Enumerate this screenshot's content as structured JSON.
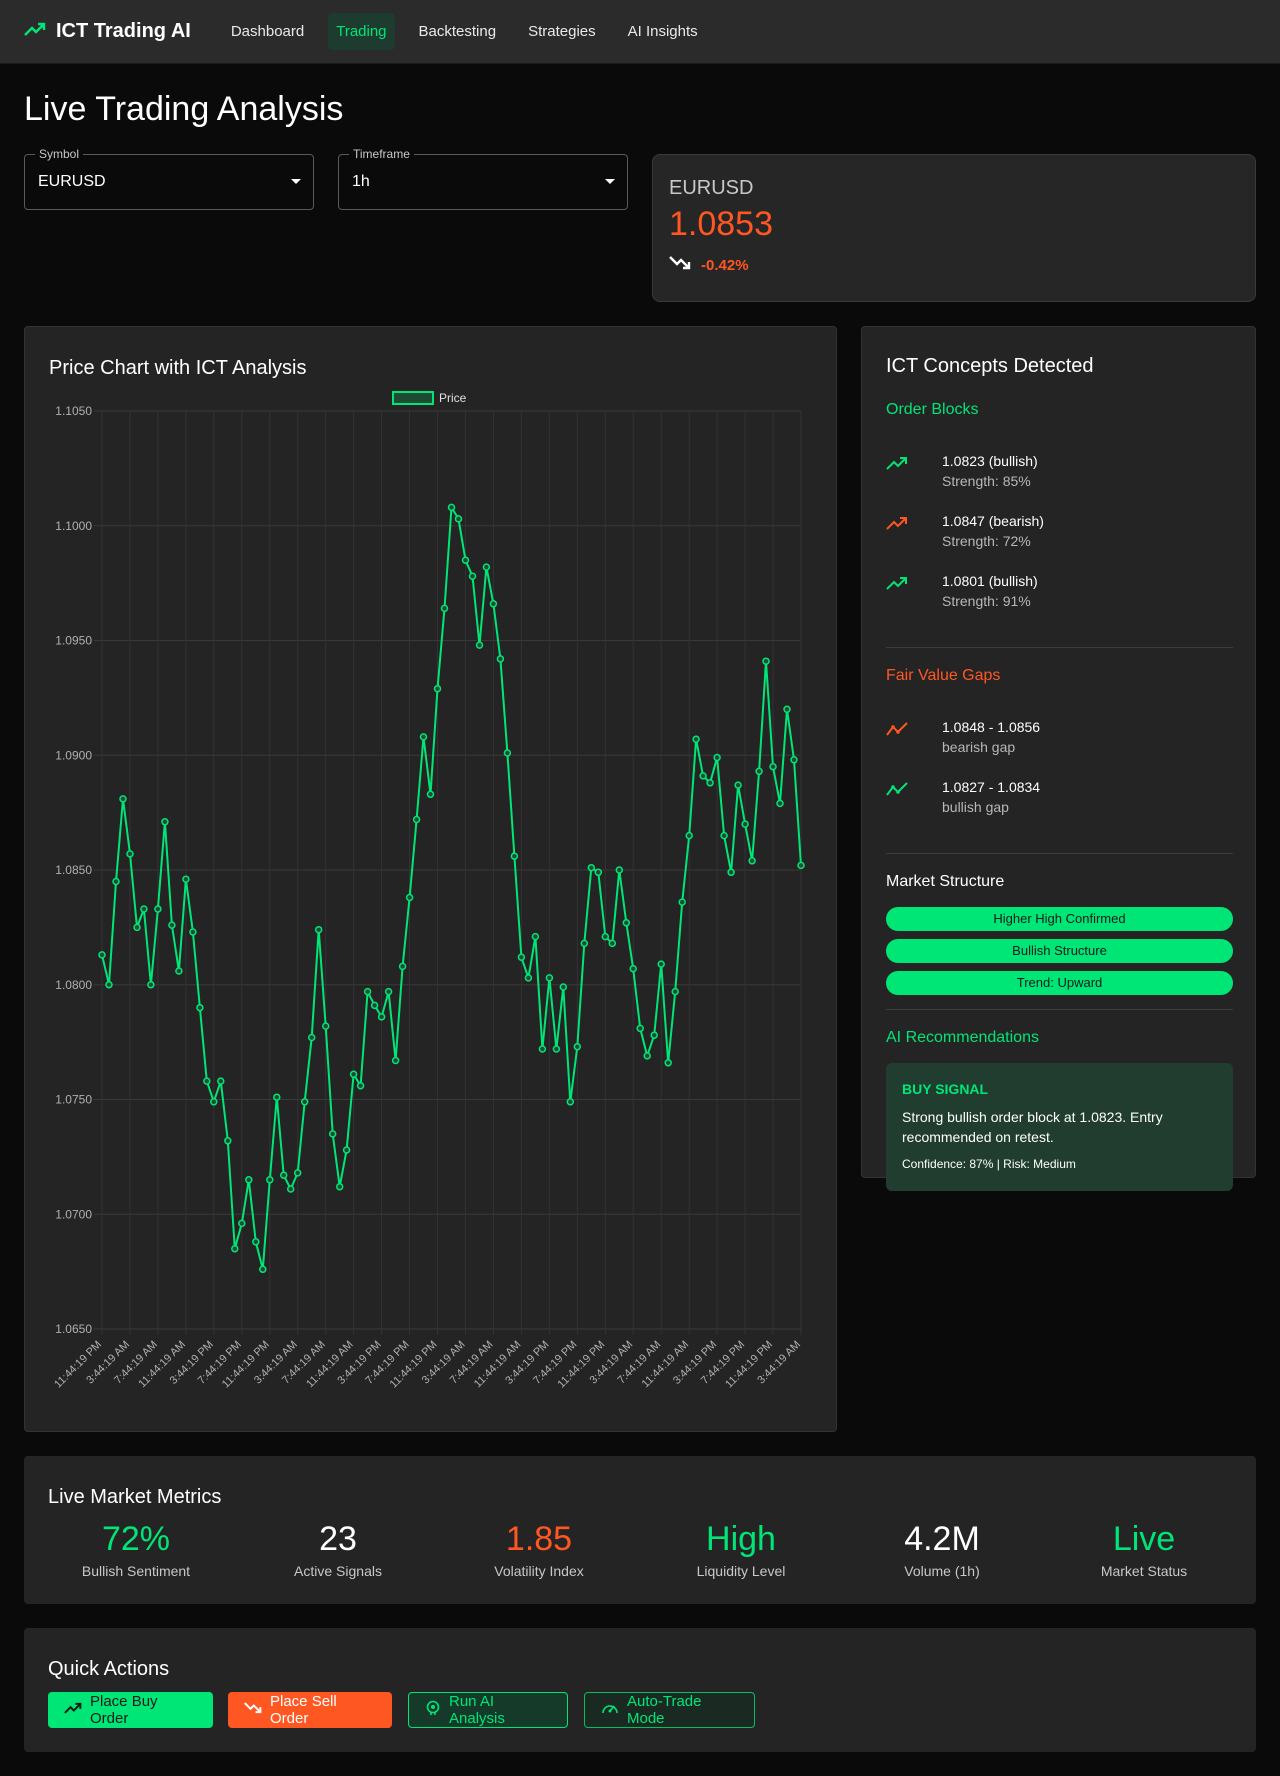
{
  "nav": {
    "brand": "ICT Trading AI",
    "links": [
      "Dashboard",
      "Trading",
      "Backtesting",
      "Strategies",
      "AI Insights"
    ],
    "active_index": 1
  },
  "page": {
    "title": "Live Trading Analysis"
  },
  "selects": {
    "symbol": {
      "label": "Symbol",
      "value": "EURUSD"
    },
    "timeframe": {
      "label": "Timeframe",
      "value": "1h"
    }
  },
  "price_card": {
    "symbol": "EURUSD",
    "price": "1.0853",
    "change": "-0.42%"
  },
  "chart": {
    "title": "Price Chart with ICT Analysis",
    "legend": "Price"
  },
  "chart_data": {
    "type": "line",
    "series": [
      {
        "name": "Price",
        "values": [
          1.0813,
          1.08,
          1.0845,
          1.0881,
          1.0857,
          1.0825,
          1.0833,
          1.08,
          1.0833,
          1.0871,
          1.0826,
          1.0806,
          1.0846,
          1.0823,
          1.079,
          1.0758,
          1.0749,
          1.0758,
          1.0732,
          1.0685,
          1.0696,
          1.0715,
          1.0688,
          1.0676,
          1.0715,
          1.0751,
          1.0717,
          1.0711,
          1.0718,
          1.0749,
          1.0777,
          1.0824,
          1.0782,
          1.0735,
          1.0712,
          1.0728,
          1.0761,
          1.0756,
          1.0797,
          1.0791,
          1.0786,
          1.0797,
          1.0767,
          1.0808,
          1.0838,
          1.0872,
          1.0908,
          1.0883,
          1.0929,
          1.0964,
          1.1008,
          1.1003,
          1.0985,
          1.0978,
          1.0948,
          1.0982,
          1.0966,
          1.0942,
          1.0901,
          1.0856,
          1.0812,
          1.0803,
          1.0821,
          1.0772,
          1.0803,
          1.0772,
          1.0799,
          1.0749,
          1.0773,
          1.0818,
          1.0851,
          1.0849,
          1.0821,
          1.0818,
          1.085,
          1.0827,
          1.0807,
          1.0781,
          1.0769,
          1.0778,
          1.0809,
          1.0766,
          1.0797,
          1.0836,
          1.0865,
          1.0907,
          1.0891,
          1.0888,
          1.0899,
          1.0865,
          1.0849,
          1.0887,
          1.087,
          1.0854,
          1.0893,
          1.0941,
          1.0895,
          1.0879,
          1.092,
          1.0898,
          1.0852
        ]
      }
    ],
    "x_tick_labels": [
      "11:44:19 PM",
      "3:44:19 AM",
      "7:44:19 AM",
      "11:44:19 AM",
      "3:44:19 PM",
      "7:44:19 PM",
      "11:44:19 PM",
      "3:44:19 AM",
      "7:44:19 AM",
      "11:44:19 AM",
      "3:44:19 PM",
      "7:44:19 PM",
      "11:44:19 PM",
      "3:44:19 AM",
      "7:44:19 AM",
      "11:44:19 AM",
      "3:44:19 PM",
      "7:44:19 PM",
      "11:44:19 PM",
      "3:44:19 AM",
      "7:44:19 AM",
      "11:44:19 AM",
      "3:44:19 PM",
      "7:44:19 PM",
      "11:44:19 PM",
      "3:44:19 AM"
    ],
    "y_ticks": [
      "1.1050",
      "1.1000",
      "1.0950",
      "1.0900",
      "1.0850",
      "1.0800",
      "1.0750",
      "1.0700",
      "1.0650"
    ],
    "ylim": [
      1.065,
      1.105
    ],
    "grid": true,
    "legend_position": "top",
    "color": "#00e676"
  },
  "ict": {
    "title": "ICT Concepts Detected",
    "order_blocks": {
      "heading": "Order Blocks",
      "items": [
        {
          "main": "1.0823 (bullish)",
          "sub": "Strength: 85%",
          "dir": "bullish"
        },
        {
          "main": "1.0847 (bearish)",
          "sub": "Strength: 72%",
          "dir": "bearish"
        },
        {
          "main": "1.0801 (bullish)",
          "sub": "Strength: 91%",
          "dir": "bullish"
        }
      ]
    },
    "fvg": {
      "heading": "Fair Value Gaps",
      "items": [
        {
          "main": "1.0848 - 1.0856",
          "sub": "bearish gap",
          "dir": "bearish"
        },
        {
          "main": "1.0827 - 1.0834",
          "sub": "bullish gap",
          "dir": "bullish"
        }
      ]
    },
    "structure": {
      "heading": "Market Structure",
      "chips": [
        "Higher High Confirmed",
        "Bullish Structure",
        "Trend: Upward"
      ]
    },
    "recommendations": {
      "heading": "AI Recommendations",
      "signal": "BUY SIGNAL",
      "text": "Strong bullish order block at 1.0823. Entry recommended on retest.",
      "meta": "Confidence: 87% | Risk: Medium"
    }
  },
  "metrics": {
    "title": "Live Market Metrics",
    "items": [
      {
        "value": "72%",
        "label": "Bullish Sentiment",
        "color": "#00e676"
      },
      {
        "value": "23",
        "label": "Active Signals",
        "color": "#ffffff"
      },
      {
        "value": "1.85",
        "label": "Volatility Index",
        "color": "#ff5722"
      },
      {
        "value": "High",
        "label": "Liquidity Level",
        "color": "#00e676"
      },
      {
        "value": "4.2M",
        "label": "Volume (1h)",
        "color": "#ffffff"
      },
      {
        "value": "Live",
        "label": "Market Status",
        "color": "#00e676"
      }
    ]
  },
  "actions": {
    "title": "Quick Actions",
    "buy": "Place Buy Order",
    "sell": "Place Sell Order",
    "ai": "Run AI Analysis",
    "auto": "Auto-Trade Mode"
  },
  "colors": {
    "accent_green": "#00e676",
    "accent_orange": "#ff5722",
    "card_bg": "#242424",
    "page_bg": "#0a0a0a"
  },
  "icons": {
    "brand": "trending-up-icon",
    "price_change": "trending-down-icon",
    "buy": "trending-up-icon",
    "sell": "trending-down-icon",
    "ai": "brain-icon",
    "auto": "speedometer-icon"
  }
}
